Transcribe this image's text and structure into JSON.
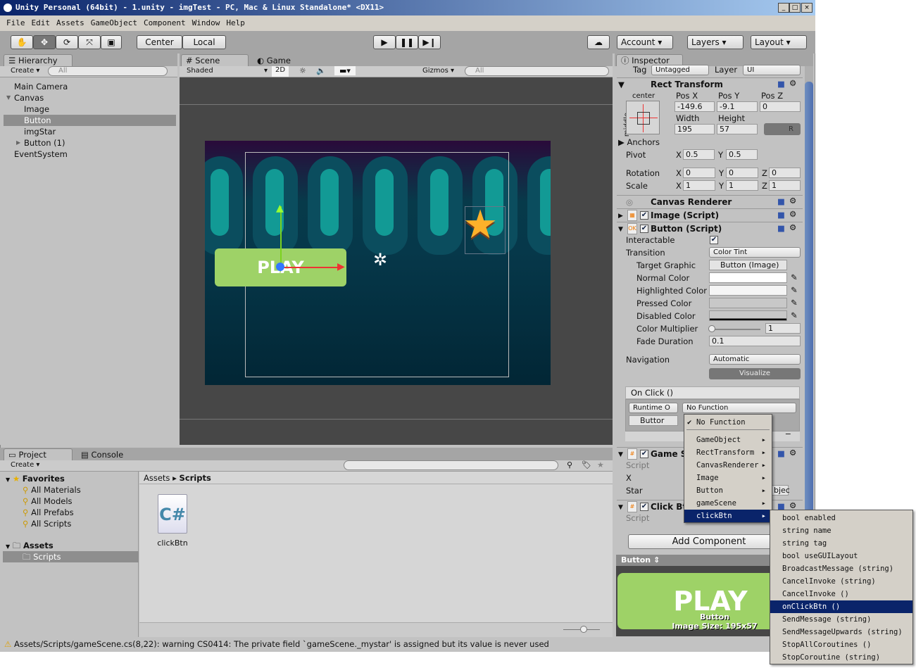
{
  "window": {
    "title": "Unity Personal (64bit) - 1.unity - imgTest - PC, Mac & Linux Standalone* <DX11>"
  },
  "menu": [
    "File",
    "Edit",
    "Assets",
    "GameObject",
    "Component",
    "Window",
    "Help"
  ],
  "toolbar": {
    "center": "Center",
    "local": "Local",
    "account": "Account",
    "layers": "Layers",
    "layout": "Layout"
  },
  "hierarchy": {
    "tab": "Hierarchy",
    "create": "Create",
    "search": "All",
    "items": [
      {
        "label": "Main Camera",
        "indent": 0
      },
      {
        "label": "Canvas",
        "indent": 0
      },
      {
        "label": "Image",
        "indent": 1
      },
      {
        "label": "Button",
        "indent": 1,
        "selected": true
      },
      {
        "label": "imgStar",
        "indent": 1
      },
      {
        "label": "Button (1)",
        "indent": 1
      },
      {
        "label": "EventSystem",
        "indent": 0
      }
    ]
  },
  "scene": {
    "tab_scene": "Scene",
    "tab_game": "Game",
    "shaded": "Shaded",
    "mode_2d": "2D",
    "gizmos": "Gizmos",
    "search": "All",
    "play_text": "PLAY"
  },
  "inspector": {
    "tab": "Inspector",
    "tag_label": "Tag",
    "tag": "Untagged",
    "layer_label": "Layer",
    "layer": "UI",
    "rect": {
      "title": "Rect Transform",
      "anchor_h": "center",
      "anchor_v": "middle",
      "posx_l": "Pos X",
      "posy_l": "Pos Y",
      "posz_l": "Pos Z",
      "posx": "-149.6",
      "posy": "-9.1",
      "posz": "0",
      "width_l": "Width",
      "height_l": "Height",
      "width": "195",
      "height": "57",
      "r": "R",
      "anchors": "Anchors",
      "pivot": "Pivot",
      "pivot_x": "0.5",
      "pivot_y": "0.5",
      "rotation": "Rotation",
      "rot": [
        "0",
        "0",
        "0"
      ],
      "scale": "Scale",
      "scl": [
        "1",
        "1",
        "1"
      ],
      "x": "X",
      "y": "Y",
      "z": "Z"
    },
    "canvas_renderer": "Canvas Renderer",
    "image_script": "Image (Script)",
    "button_script": "Button (Script)",
    "button": {
      "interactable": "Interactable",
      "transition": "Transition",
      "transition_val": "Color Tint",
      "target_graphic": "Target Graphic",
      "target_graphic_val": "Button (Image)",
      "normal": "Normal Color",
      "highlighted": "Highlighted Color",
      "pressed": "Pressed Color",
      "disabled": "Disabled Color",
      "multiplier": "Color Multiplier",
      "multiplier_val": "1",
      "fade": "Fade Duration",
      "fade_val": "0.1",
      "navigation": "Navigation",
      "navigation_val": "Automatic",
      "visualize": "Visualize",
      "onclick": "On Click ()",
      "runtime": "Runtime O",
      "function": "No Function",
      "object": "Buttor"
    },
    "game_scene": {
      "title": "Game S",
      "script": "Script",
      "x": "X",
      "star": "Star",
      "star_val": "bjec"
    },
    "click_btn": {
      "title": "Click Bt",
      "script": "Script"
    },
    "add_component": "Add Component",
    "preview": {
      "title": "Button",
      "play": "PLAY",
      "name": "Button",
      "size": "Image Size: 195x57"
    }
  },
  "function_menu": {
    "checked": "No Function",
    "items": [
      "GameObject",
      "RectTransform",
      "CanvasRenderer",
      "Image",
      "Button",
      "gameScene",
      "clickBtn"
    ],
    "highlighted": "clickBtn"
  },
  "submenu": {
    "items": [
      "bool enabled",
      "string name",
      "string tag",
      "bool useGUILayout",
      "BroadcastMessage (string)",
      "CancelInvoke (string)",
      "CancelInvoke ()",
      "onClickBtn ()",
      "SendMessage (string)",
      "SendMessageUpwards (string)",
      "StopAllCoroutines ()",
      "StopCoroutine (string)"
    ],
    "highlighted": "onClickBtn ()"
  },
  "project": {
    "tab": "Project",
    "console": "Console",
    "create": "Create",
    "favorites": "Favorites",
    "fav_items": [
      "All Materials",
      "All Models",
      "All Prefabs",
      "All Scripts"
    ],
    "assets": "Assets",
    "scripts": "Scripts",
    "breadcrumb": [
      "Assets",
      "Scripts"
    ],
    "file": "clickBtn"
  },
  "status": {
    "text": "Assets/Scripts/gameScene.cs(8,22): warning CS0414: The private field `gameScene._mystar' is assigned but its value is never used"
  }
}
